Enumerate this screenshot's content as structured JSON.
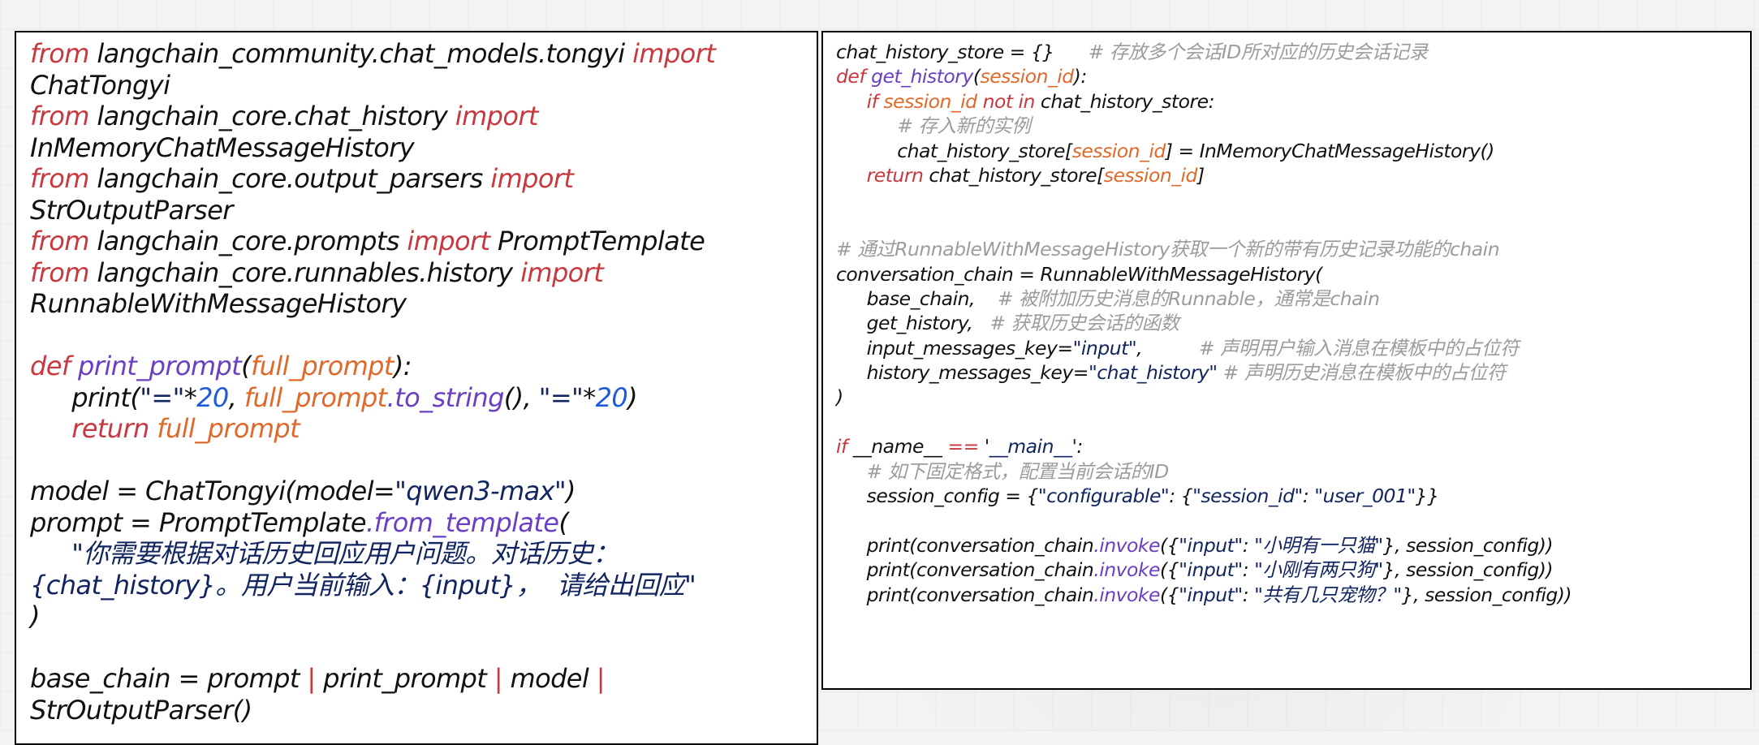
{
  "left_code": [
    {
      "indent": 0,
      "tokens": [
        [
          "kw",
          "from"
        ],
        [
          "tx",
          " langchain_community.chat_models.tongyi "
        ],
        [
          "kw",
          "import"
        ]
      ]
    },
    {
      "indent": 0,
      "tokens": [
        [
          "tx",
          "ChatTongyi"
        ]
      ]
    },
    {
      "indent": 0,
      "tokens": [
        [
          "kw",
          "from"
        ],
        [
          "tx",
          " langchain_core.chat_history "
        ],
        [
          "kw",
          "import"
        ]
      ]
    },
    {
      "indent": 0,
      "tokens": [
        [
          "tx",
          "InMemoryChatMessageHistory"
        ]
      ]
    },
    {
      "indent": 0,
      "tokens": [
        [
          "kw",
          "from"
        ],
        [
          "tx",
          " langchain_core.output_parsers "
        ],
        [
          "kw",
          "import"
        ]
      ]
    },
    {
      "indent": 0,
      "tokens": [
        [
          "tx",
          "StrOutputParser"
        ]
      ]
    },
    {
      "indent": 0,
      "tokens": [
        [
          "kw",
          "from"
        ],
        [
          "tx",
          " langchain_core.prompts "
        ],
        [
          "kw",
          "import"
        ],
        [
          "tx",
          " PromptTemplate"
        ]
      ]
    },
    {
      "indent": 0,
      "tokens": [
        [
          "kw",
          "from"
        ],
        [
          "tx",
          " langchain_core.runnables.history "
        ],
        [
          "kw",
          "import"
        ]
      ]
    },
    {
      "indent": 0,
      "tokens": [
        [
          "tx",
          "RunnableWithMessageHistory"
        ]
      ]
    },
    {
      "indent": 0,
      "tokens": []
    },
    {
      "indent": 0,
      "tokens": [
        [
          "kw",
          "def"
        ],
        [
          "tx",
          " "
        ],
        [
          "fn",
          "print_prompt"
        ],
        [
          "tx",
          "("
        ],
        [
          "pr",
          "full_prompt"
        ],
        [
          "tx",
          "):"
        ]
      ]
    },
    {
      "indent": 1,
      "tokens": [
        [
          "tx",
          "print("
        ],
        [
          "st",
          "\"=\""
        ],
        [
          "tx",
          "*"
        ],
        [
          "nu",
          "20"
        ],
        [
          "tx",
          ", "
        ],
        [
          "pr",
          "full_prompt"
        ],
        [
          "fn",
          ".to_string"
        ],
        [
          "tx",
          "(), "
        ],
        [
          "st",
          "\"=\""
        ],
        [
          "tx",
          "*"
        ],
        [
          "nu",
          "20"
        ],
        [
          "tx",
          ")"
        ]
      ]
    },
    {
      "indent": 1,
      "tokens": [
        [
          "kw",
          "return"
        ],
        [
          "tx",
          " "
        ],
        [
          "pr",
          "full_prompt"
        ]
      ]
    },
    {
      "indent": 0,
      "tokens": []
    },
    {
      "indent": 0,
      "tokens": [
        [
          "tx",
          "model = ChatTongyi(model="
        ],
        [
          "st",
          "\"qwen3-max\""
        ],
        [
          "tx",
          ")"
        ]
      ]
    },
    {
      "indent": 0,
      "tokens": [
        [
          "tx",
          "prompt = PromptTemplate"
        ],
        [
          "fn",
          ".from_template"
        ],
        [
          "tx",
          "("
        ]
      ]
    },
    {
      "indent": 1,
      "tokens": [
        [
          "st",
          "\"你需要根据对话历史回应用户问题。对话历史："
        ]
      ]
    },
    {
      "indent": 0,
      "tokens": [
        [
          "st",
          "{chat_history}。用户当前输入：{input}，  请给出回应\""
        ]
      ]
    },
    {
      "indent": 0,
      "tokens": [
        [
          "tx",
          ")"
        ]
      ]
    },
    {
      "indent": 0,
      "tokens": []
    },
    {
      "indent": 0,
      "tokens": [
        [
          "tx",
          "base_chain = prompt "
        ],
        [
          "kw",
          "|"
        ],
        [
          "tx",
          " print_prompt "
        ],
        [
          "kw",
          "|"
        ],
        [
          "tx",
          " model "
        ],
        [
          "kw",
          "|"
        ]
      ]
    },
    {
      "indent": 0,
      "tokens": [
        [
          "tx",
          "StrOutputParser()"
        ]
      ]
    }
  ],
  "right_code": [
    {
      "indent": 0,
      "tokens": [
        [
          "tx",
          "chat_history_store = {}      "
        ],
        [
          "cm",
          "# 存放多个会话ID所对应的历史会话记录"
        ]
      ]
    },
    {
      "indent": 0,
      "tokens": [
        [
          "kw",
          "def"
        ],
        [
          "tx",
          " "
        ],
        [
          "fn",
          "get_history"
        ],
        [
          "tx",
          "("
        ],
        [
          "pr",
          "session_id"
        ],
        [
          "tx",
          "):"
        ]
      ]
    },
    {
      "indent": 1,
      "tokens": [
        [
          "kw",
          "if"
        ],
        [
          "tx",
          " "
        ],
        [
          "pr",
          "session_id"
        ],
        [
          "tx",
          " "
        ],
        [
          "kw",
          "not in"
        ],
        [
          "tx",
          " chat_history_store:"
        ]
      ]
    },
    {
      "indent": 2,
      "tokens": [
        [
          "cm",
          "# 存入新的实例"
        ]
      ]
    },
    {
      "indent": 2,
      "tokens": [
        [
          "tx",
          "chat_history_store["
        ],
        [
          "pr",
          "session_id"
        ],
        [
          "tx",
          "] = InMemoryChatMessageHistory()"
        ]
      ]
    },
    {
      "indent": 1,
      "tokens": [
        [
          "kw",
          "return"
        ],
        [
          "tx",
          " chat_history_store["
        ],
        [
          "pr",
          "session_id"
        ],
        [
          "tx",
          "]"
        ]
      ]
    },
    {
      "indent": 0,
      "tokens": []
    },
    {
      "indent": 0,
      "tokens": []
    },
    {
      "indent": 0,
      "tokens": [
        [
          "cm",
          "# 通过RunnableWithMessageHistory获取一个新的带有历史记录功能的chain"
        ]
      ]
    },
    {
      "indent": 0,
      "tokens": [
        [
          "tx",
          "conversation_chain = RunnableWithMessageHistory("
        ]
      ]
    },
    {
      "indent": 1,
      "tokens": [
        [
          "tx",
          "base_chain,    "
        ],
        [
          "cm",
          "# 被附加历史消息的Runnable，通常是chain"
        ]
      ]
    },
    {
      "indent": 1,
      "tokens": [
        [
          "tx",
          "get_history,   "
        ],
        [
          "cm",
          "# 获取历史会话的函数"
        ]
      ]
    },
    {
      "indent": 1,
      "tokens": [
        [
          "tx",
          "input_messages_key="
        ],
        [
          "st",
          "\"input\""
        ],
        [
          "tx",
          ",          "
        ],
        [
          "cm",
          "# 声明用户输入消息在模板中的占位符"
        ]
      ]
    },
    {
      "indent": 1,
      "tokens": [
        [
          "tx",
          "history_messages_key="
        ],
        [
          "st",
          "\"chat_history\""
        ],
        [
          "tx",
          " "
        ],
        [
          "cm",
          "# 声明历史消息在模板中的占位符"
        ]
      ]
    },
    {
      "indent": 0,
      "tokens": [
        [
          "tx",
          ")"
        ]
      ]
    },
    {
      "indent": 0,
      "tokens": []
    },
    {
      "indent": 0,
      "tokens": [
        [
          "kw",
          "if"
        ],
        [
          "tx",
          " __name__ "
        ],
        [
          "kw",
          "=="
        ],
        [
          "tx",
          " "
        ],
        [
          "st",
          "'__main__'"
        ],
        [
          "tx",
          ":"
        ]
      ]
    },
    {
      "indent": 1,
      "tokens": [
        [
          "cm",
          "# 如下固定格式，配置当前会话的ID"
        ]
      ]
    },
    {
      "indent": 1,
      "tokens": [
        [
          "tx",
          "session_config = {"
        ],
        [
          "st",
          "\"configurable\""
        ],
        [
          "tx",
          ": {"
        ],
        [
          "st",
          "\"session_id\""
        ],
        [
          "tx",
          ": "
        ],
        [
          "st",
          "\"user_001\""
        ],
        [
          "tx",
          "}}"
        ]
      ]
    },
    {
      "indent": 0,
      "tokens": []
    },
    {
      "indent": 1,
      "tokens": [
        [
          "tx",
          "print(conversation_chain"
        ],
        [
          "fn",
          ".invoke"
        ],
        [
          "tx",
          "({"
        ],
        [
          "st",
          "\"input\""
        ],
        [
          "tx",
          ": "
        ],
        [
          "st",
          "\"小明有一只猫\""
        ],
        [
          "tx",
          "}, session_config))"
        ]
      ]
    },
    {
      "indent": 1,
      "tokens": [
        [
          "tx",
          "print(conversation_chain"
        ],
        [
          "fn",
          ".invoke"
        ],
        [
          "tx",
          "({"
        ],
        [
          "st",
          "\"input\""
        ],
        [
          "tx",
          ": "
        ],
        [
          "st",
          "\"小刚有两只狗\""
        ],
        [
          "tx",
          "}, session_config))"
        ]
      ]
    },
    {
      "indent": 1,
      "tokens": [
        [
          "tx",
          "print(conversation_chain"
        ],
        [
          "fn",
          ".invoke"
        ],
        [
          "tx",
          "({"
        ],
        [
          "st",
          "\"input\""
        ],
        [
          "tx",
          ": "
        ],
        [
          "st",
          "\"共有几只宠物？\""
        ],
        [
          "tx",
          "}, session_config))"
        ]
      ]
    }
  ],
  "colors": {
    "keyword": "#c8383f",
    "function": "#6a3fc4",
    "param": "#e0692a",
    "string": "#122560",
    "number": "#1f5bd8",
    "comment": "#9c9c9c",
    "text": "#111111"
  }
}
